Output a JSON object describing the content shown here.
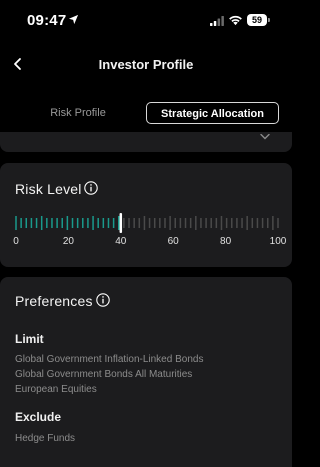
{
  "status_bar": {
    "time": "09:47",
    "battery": "59",
    "icons": [
      "location-arrow-icon",
      "signal-icon",
      "wifi-icon",
      "battery-icon"
    ]
  },
  "header": {
    "title": "Investor Profile",
    "back_icon": "chevron-left-icon"
  },
  "tabs": [
    {
      "label": "Risk Profile",
      "selected": false
    },
    {
      "label": "Strategic Allocation",
      "selected": true
    }
  ],
  "risk_level": {
    "title": "Risk Level",
    "value": 40,
    "min": 0,
    "max": 100,
    "tick_labels": [
      "0",
      "20",
      "40",
      "60",
      "80",
      "100"
    ],
    "active_color": "#1a9a8c",
    "inactive_color": "#4a4a4a",
    "indicator_color": "#ffffff"
  },
  "preferences": {
    "title": "Preferences",
    "limit": {
      "label": "Limit",
      "items": [
        "Global Government Inflation-Linked Bonds",
        "Global Government Bonds All Maturities",
        "European Equities"
      ]
    },
    "exclude": {
      "label": "Exclude",
      "items": [
        "Hedge Funds"
      ]
    }
  }
}
